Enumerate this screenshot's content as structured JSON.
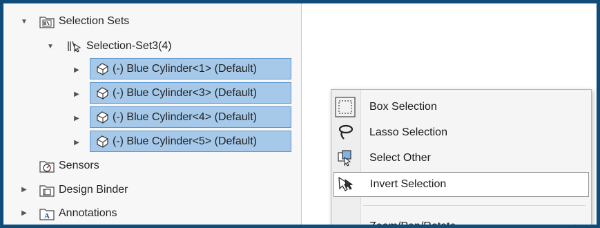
{
  "tree": {
    "selection_sets": "Selection Sets",
    "selection_set": "Selection-Set3(4)",
    "components": [
      "(-) Blue Cylinder<1> (Default)",
      "(-) Blue Cylinder<3> (Default)",
      "(-) Blue Cylinder<4> (Default)",
      "(-) Blue Cylinder<5> (Default)"
    ],
    "sensors": "Sensors",
    "design_binder": "Design Binder",
    "annotations": "Annotations"
  },
  "context_menu": {
    "items": [
      {
        "label": "Box Selection",
        "icon": "box-selection-icon"
      },
      {
        "label": "Lasso Selection",
        "icon": "lasso-selection-icon"
      },
      {
        "label": "Select Other",
        "icon": "select-other-icon"
      },
      {
        "label": "Invert Selection",
        "icon": "invert-selection-icon"
      },
      {
        "label": "Zoom/Pan/Rotate",
        "icon": ""
      }
    ]
  },
  "colors": {
    "frame": "#0f4c7a",
    "selection_fill": "#a6c9ea",
    "selection_border": "#5b95cd"
  }
}
